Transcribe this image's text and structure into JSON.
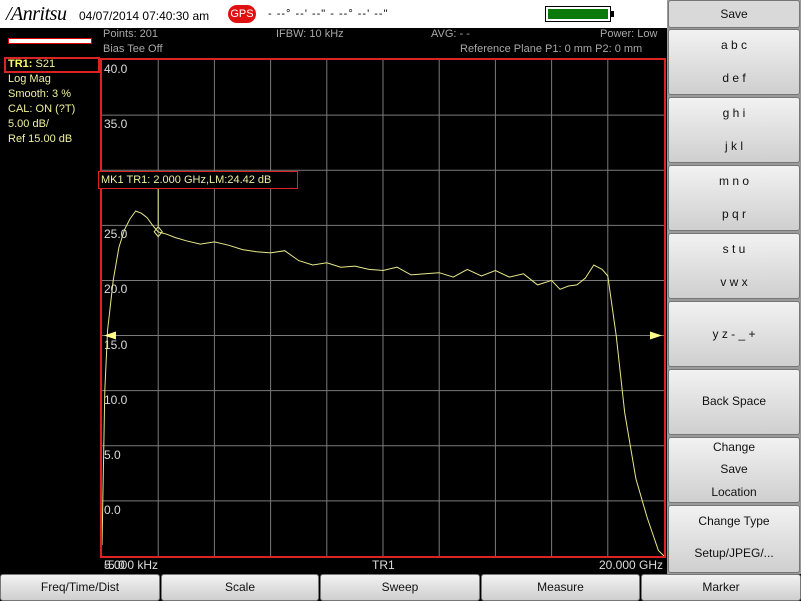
{
  "header": {
    "logo": "/Anritsu",
    "datetime": "04/07/2014 07:40:30 am",
    "gps": "GPS",
    "coords": "- --° --' --\" - --° --' --\"",
    "battery_level": 1.0
  },
  "info": {
    "points": "Points: 201",
    "ifbw": "IFBW: 10 kHz",
    "avg": "AVG: - -",
    "power": "Power: Low",
    "bias_tee": "Bias Tee Off",
    "ref_plane": "Reference Plane P1: 0 mm P2: 0 mm"
  },
  "trace": {
    "label": "TR1:",
    "param": "S21",
    "format": "Log Mag",
    "smooth": "Smooth: 3 %",
    "cal": "CAL: ON (?T)",
    "scale": "5.00 dB/",
    "ref": "Ref 15.00 dB"
  },
  "marker": {
    "readout": "MK1 TR1:  2.000 GHz,LM:24.42 dB"
  },
  "axis": {
    "start": "5.000 kHz",
    "center": "TR1",
    "stop": "20.000 GHz"
  },
  "softkeys": {
    "title": "Save",
    "abc": "a b c",
    "def": "d e f",
    "ghi": "g h i",
    "jkl": "j k l",
    "mno": "m n o",
    "pqr": "p q r",
    "stu": "s t u",
    "vwx": "v w x",
    "yz": "y z - _ +",
    "backspace": "Back Space",
    "change_save_1": "Change",
    "change_save_2": "Save",
    "change_save_3": "Location",
    "change_type_1": "Change Type",
    "change_type_2": "Setup/JPEG/..."
  },
  "bottom_menu": [
    "Freq/Time/Dist",
    "Scale",
    "Sweep",
    "Measure",
    "Marker"
  ],
  "colors": {
    "trace": "#e8e88a",
    "frame": "#d22222",
    "grid": "#7a7a7a",
    "gps": "#e01010",
    "battery": "#0b7a0b"
  },
  "chart_data": {
    "type": "line",
    "ylim": [
      -5,
      40
    ],
    "xlim": [
      0,
      20
    ],
    "xunit": "GHz",
    "yticks": [
      "40.0",
      "35.0",
      "30.0",
      "25.0",
      "20.0",
      "15.0",
      "10.0",
      "5.0",
      "0.0",
      "-5.0"
    ],
    "series": [
      {
        "x": [
          0.0,
          0.1,
          0.2,
          0.4,
          0.6,
          0.8,
          1.0,
          1.2,
          1.4,
          1.6,
          1.8,
          2.0,
          2.3,
          2.6,
          3.0,
          3.5,
          4.0,
          4.5,
          5.0,
          5.5,
          6.0,
          6.5,
          7.0,
          7.5,
          8.0,
          8.5,
          9.0,
          9.5,
          10.0,
          10.5,
          11.0,
          11.5,
          12.0,
          12.5,
          13.0,
          13.5,
          14.0,
          14.5,
          15.0,
          15.5,
          16.0,
          16.3,
          16.6,
          16.9,
          17.2,
          17.5,
          17.8,
          18.0,
          18.3,
          18.6,
          19.0,
          19.4,
          19.8,
          20.0
        ],
        "y": [
          -4.0,
          10.0,
          15.5,
          20.0,
          23.0,
          24.6,
          25.6,
          26.3,
          26.1,
          25.7,
          25.0,
          24.4,
          24.2,
          23.9,
          23.6,
          23.3,
          23.5,
          23.2,
          22.8,
          22.6,
          22.5,
          22.7,
          21.8,
          21.4,
          21.6,
          21.2,
          21.3,
          21.0,
          20.9,
          21.2,
          20.5,
          20.6,
          20.7,
          20.3,
          21.0,
          20.4,
          20.9,
          20.3,
          20.6,
          19.6,
          20.0,
          19.2,
          19.5,
          19.6,
          20.2,
          21.4,
          21.0,
          20.4,
          15.0,
          8.0,
          2.0,
          -1.5,
          -4.5,
          -5.0
        ]
      }
    ],
    "markers": [
      {
        "name": "MK1",
        "x": 2.0,
        "y": 24.42
      }
    ],
    "ref_level": 15.0,
    "grid": true
  }
}
